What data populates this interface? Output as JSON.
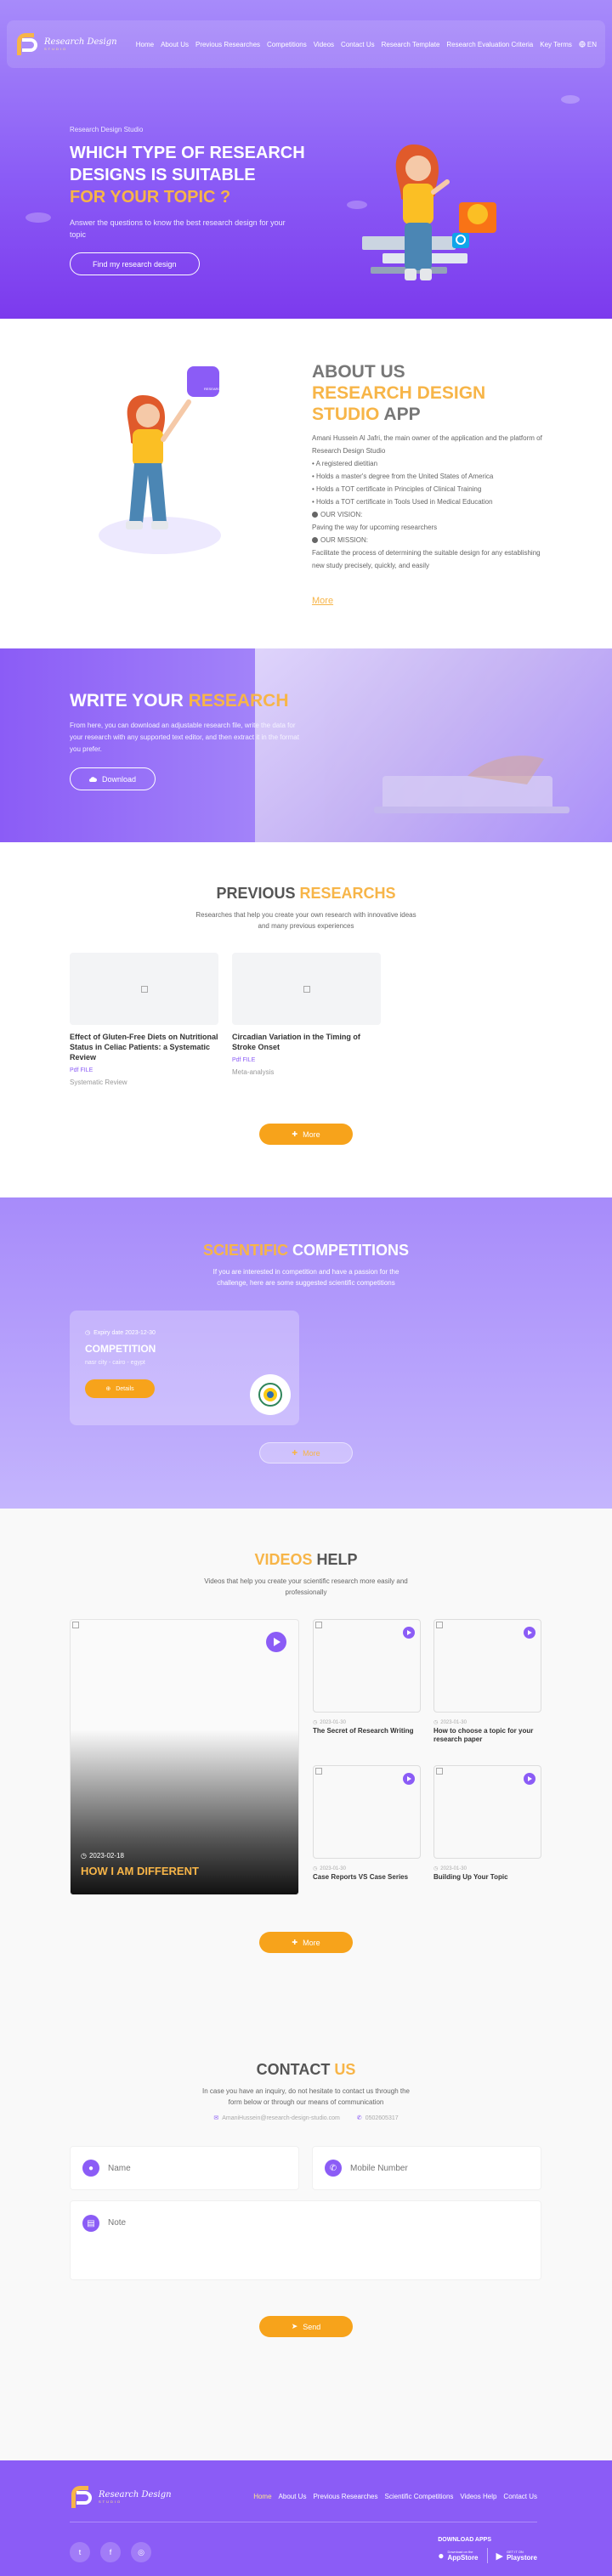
{
  "brand": {
    "line1": "Research Design",
    "line2": "STUDIO"
  },
  "nav": {
    "items": [
      "Home",
      "About Us",
      "Previous Researches",
      "Competitions",
      "Videos",
      "Contact Us",
      "Research Template",
      "Research Evaluation Criteria",
      "Key Terms"
    ],
    "lang": "EN"
  },
  "hero": {
    "crumb": "Research Design Studio",
    "title_a": "WHICH TYPE OF RESEARCH DESIGNS IS SUITABLE",
    "title_b": "FOR YOUR TOPIC ?",
    "subtitle": "Answer the questions to know the best research design for your topic",
    "button": "Find my research design"
  },
  "about": {
    "title_a": "ABOUT US",
    "title_b": "RESEARCH DESIGN STUDIO",
    "title_c": "APP",
    "intro": "Amani Hussein Al Jafri, the main owner of the application and the platform of Research Design Studio",
    "bullets": [
      "• A registered dietitian",
      "• Holds a master's degree from the United States of America",
      "• Holds a TOT certificate in Principles of Clinical Training",
      "• Holds a TOT certificate in Tools Used in Medical Education"
    ],
    "vision_label": "OUR VISION:",
    "vision_text": "Paving the way for upcoming researchers",
    "mission_label": "OUR MISSION:",
    "mission_text": "Facilitate the process of determining the suitable design for any establishing new study precisely, quickly, and easily",
    "more": "More",
    "hand_label": "RESEARCH"
  },
  "write": {
    "title_a": "WRITE YOUR",
    "title_b": "RESEARCH",
    "subtitle": "From here, you can download an adjustable research file, write the data for your research with any supported text editor, and then extract it in the format you prefer.",
    "button": "Download"
  },
  "previous": {
    "title_a": "PREVIOUS",
    "title_b": "RESEARCHS",
    "subtitle": "Researches that help you create your own research with innovative ideas and many previous experiences",
    "cards": [
      {
        "title": "Effect of Gluten-Free Diets on Nutritional Status in Celiac Patients: a Systematic Review",
        "tag": "Pdf FILE",
        "category": "Systematic Review"
      },
      {
        "title": "Circadian Variation in the Timing of Stroke Onset",
        "tag": "Pdf FILE",
        "category": "Meta-analysis"
      }
    ],
    "more": "More"
  },
  "competitions": {
    "title_a": "SCIENTIFIC",
    "title_b": "COMPETITIONS",
    "subtitle": "If you are interested in competition and have a passion for the challenge, here are some suggested scientific competitions",
    "card": {
      "date": "Expiry date 2023-12-30",
      "name": "COMPETITION",
      "place": "nasr city - cairo - egypt",
      "button": "Details"
    },
    "more": "More"
  },
  "videos": {
    "title_a": "VIDEOS",
    "title_b": "HELP",
    "subtitle": "Videos that help you create your scientific research more easily and professionally",
    "featured": {
      "date": "2023-02-18",
      "title": "HOW I AM DIFFERENT"
    },
    "items": [
      {
        "date": "2023-01-30",
        "title": "The Secret of Research Writing"
      },
      {
        "date": "2023-01-30",
        "title": "How to choose a topic for your research paper"
      },
      {
        "date": "2023-01-30",
        "title": "Case Reports VS Case Series"
      },
      {
        "date": "2023-01-30",
        "title": "Building Up Your Topic"
      }
    ],
    "more": "More"
  },
  "contact": {
    "title_a": "CONTACT",
    "title_b": "US",
    "subtitle": "In case you have an inquiry, do not hesitate to contact us through the form below or through our means of communication",
    "email": "AmaniHussein@research-design-studio.com",
    "phone": "0502605317",
    "name_placeholder": "Name",
    "mobile_placeholder": "Mobile Number",
    "note_placeholder": "Note",
    "send": "Send"
  },
  "footer": {
    "links": [
      "Home",
      "About Us",
      "Previous Researches",
      "Scientific Competitions",
      "Videos Help",
      "Contact Us"
    ],
    "download_title": "DOWNLOAD APPS",
    "appstore_small": "Download on the",
    "appstore": "AppStore",
    "playstore_small": "GET IT ON",
    "playstore": "Playstore"
  },
  "colors": {
    "primary": "#8b5cf6",
    "accent": "#f7b548",
    "button": "#f7a31b"
  }
}
